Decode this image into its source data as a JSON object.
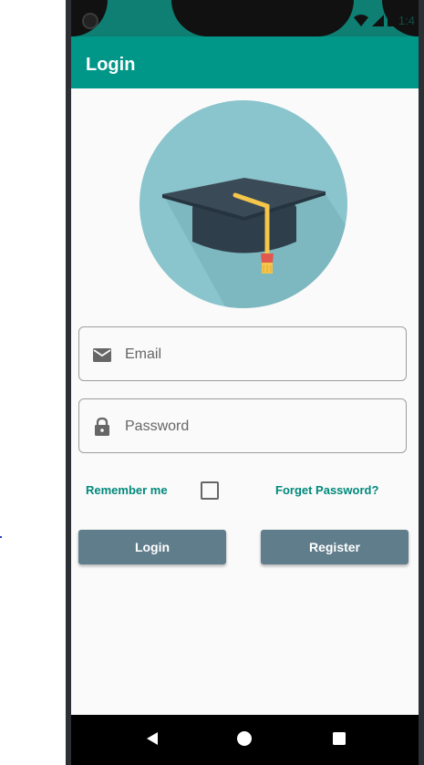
{
  "status_bar": {
    "time": "1:4"
  },
  "app_bar": {
    "title": "Login"
  },
  "form": {
    "email_placeholder": "Email",
    "password_placeholder": "Password",
    "remember_label": "Remember me",
    "remember_checked": false,
    "forgot_label": "Forget Password?"
  },
  "buttons": {
    "login_label": "Login",
    "register_label": "Register"
  },
  "icons": {
    "email": "email-icon",
    "password": "lock-icon",
    "logo": "graduation-cap-icon",
    "nav_back": "back-triangle-icon",
    "nav_home": "home-circle-icon",
    "nav_recents": "recents-square-icon"
  },
  "colors": {
    "primary": "#009688",
    "accent_text": "#00897b",
    "button": "#607d8b",
    "logo_circle": "#8ac4cc"
  }
}
